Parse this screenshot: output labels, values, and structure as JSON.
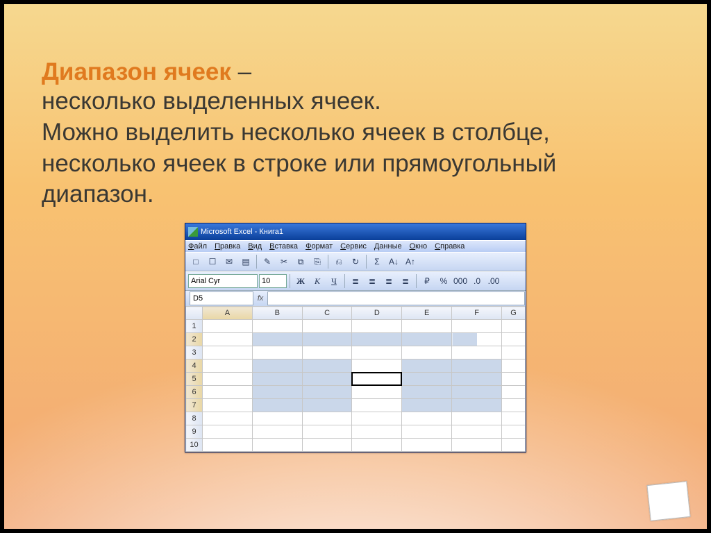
{
  "slide": {
    "heading": "Диапазон ячеек",
    "heading_dash": " –",
    "body": "несколько выделенных ячеек.\nМожно выделить несколько ячеек в столбце, несколько ячеек в строке или прямоугольный диапазон."
  },
  "excel": {
    "title": "Microsoft Excel - Книга1",
    "menubar": [
      "Файл",
      "Правка",
      "Вид",
      "Вставка",
      "Формат",
      "Сервис",
      "Данные",
      "Окно",
      "Справка"
    ],
    "font_name": "Arial Cyr",
    "font_size": "10",
    "style_labels": {
      "bold": "Ж",
      "italic": "К",
      "underline": "Ч"
    },
    "toolbar_icons_row1": [
      "□",
      "☐",
      "✉",
      "▤",
      "✎",
      "✂",
      "⧉",
      "⎘",
      "⎌",
      "↻",
      "Σ",
      "A↓",
      "A↑"
    ],
    "toolbar_icons_row2_right": [
      "≣",
      "≣",
      "≣",
      "≣",
      "₽",
      "%",
      "000",
      ".0",
      ".00"
    ],
    "name_box": "D5",
    "fx_label": "fx",
    "columns": [
      "A",
      "B",
      "C",
      "D",
      "E",
      "F",
      "G"
    ],
    "rows": [
      "1",
      "2",
      "3",
      "4",
      "5",
      "6",
      "7",
      "8",
      "9",
      "10"
    ],
    "selected_cells": [
      "B2",
      "C2",
      "D2",
      "E2",
      "F2",
      "B4",
      "C4",
      "E4",
      "F4",
      "B5",
      "C5",
      "E5",
      "F5",
      "B6",
      "C6",
      "E6",
      "F6",
      "B7",
      "C7",
      "E7",
      "F7"
    ],
    "active_cell": "D5",
    "selected_row_headers": [
      "2",
      "4",
      "5",
      "6",
      "7"
    ],
    "highlight_col_header": "A"
  }
}
